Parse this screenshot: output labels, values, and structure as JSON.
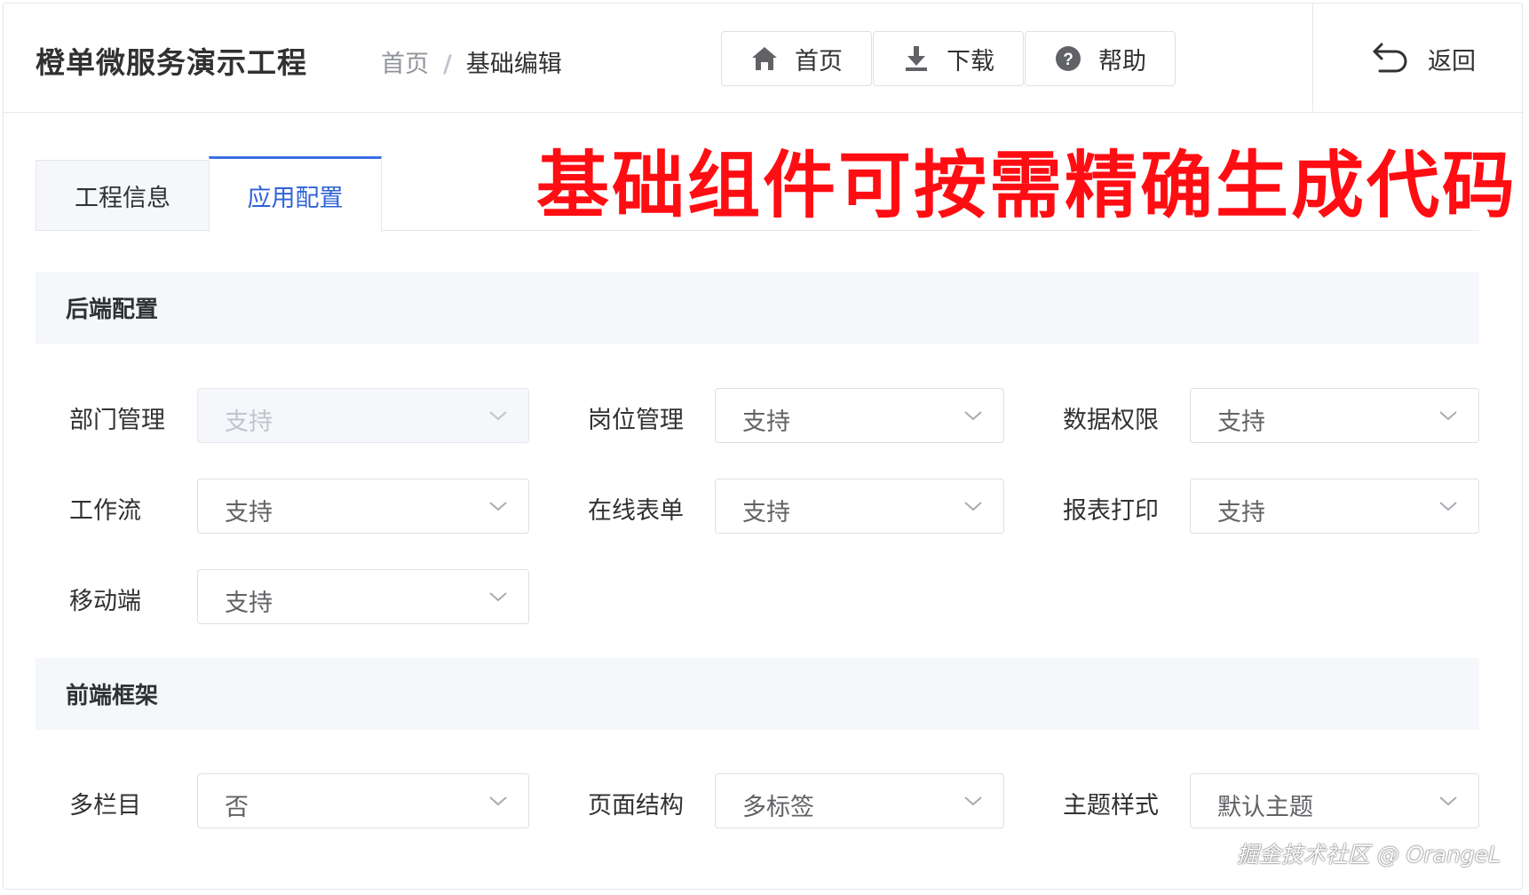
{
  "header": {
    "app_title": "橙单微服务演示工程",
    "breadcrumb": {
      "home": "首页",
      "separator": "/",
      "current": "基础编辑"
    },
    "buttons": {
      "home": "首页",
      "download": "下载",
      "help": "帮助"
    },
    "back": "返回"
  },
  "tabs": [
    {
      "label": "工程信息",
      "active": false
    },
    {
      "label": "应用配置",
      "active": true
    }
  ],
  "banner": "基础组件可按需精确生成代码",
  "sections": {
    "backend": {
      "title": "后端配置",
      "fields": [
        {
          "label": "部门管理",
          "value": "支持",
          "disabled": true
        },
        {
          "label": "岗位管理",
          "value": "支持",
          "disabled": false
        },
        {
          "label": "数据权限",
          "value": "支持",
          "disabled": false
        },
        {
          "label": "工作流",
          "value": "支持",
          "disabled": false
        },
        {
          "label": "在线表单",
          "value": "支持",
          "disabled": false
        },
        {
          "label": "报表打印",
          "value": "支持",
          "disabled": false
        },
        {
          "label": "移动端",
          "value": "支持",
          "disabled": false
        }
      ]
    },
    "frontend": {
      "title": "前端框架",
      "fields": [
        {
          "label": "多栏目",
          "value": "否",
          "disabled": false
        },
        {
          "label": "页面结构",
          "value": "多标签",
          "disabled": false
        },
        {
          "label": "主题样式",
          "value": "默认主题",
          "disabled": false
        }
      ]
    }
  },
  "watermark": "掘金技术社区 @ OrangeL",
  "colors": {
    "accent": "#3a6ee6",
    "active_tab_text": "#2f62d8",
    "banner": "#ff0d12",
    "section_bg": "#f5f7fa",
    "border": "#dcdfe6"
  },
  "icons": {
    "home": "home-icon",
    "download": "download-icon",
    "help": "help-icon",
    "back": "back-arrow-icon",
    "select_caret": "chevron-down-icon"
  }
}
